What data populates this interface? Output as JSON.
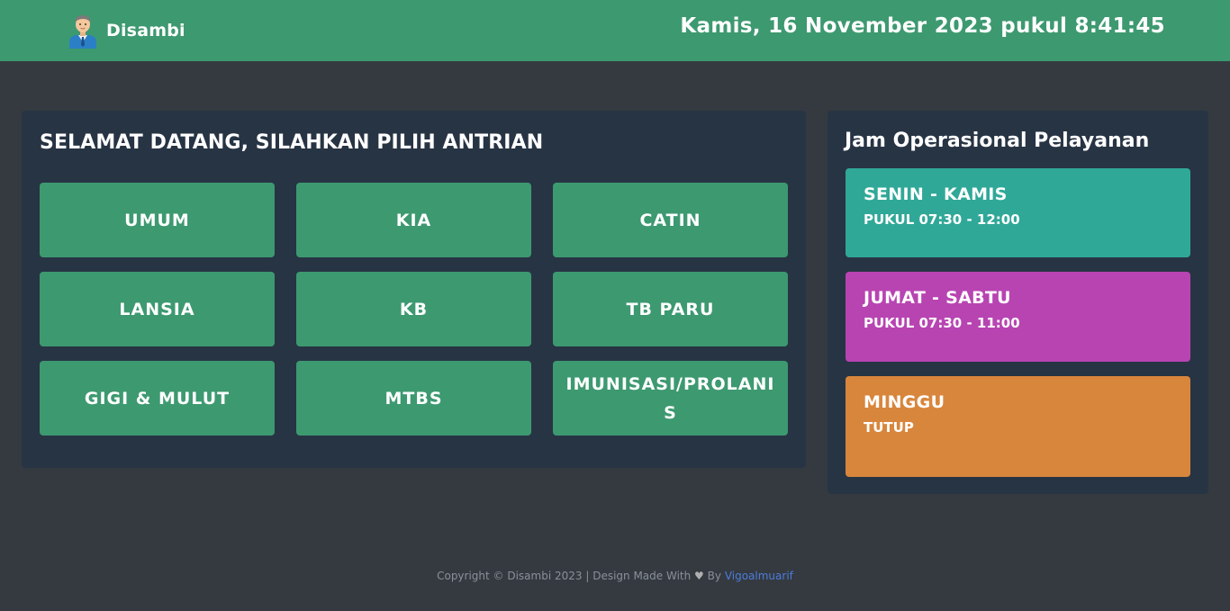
{
  "header": {
    "brand_name": "Disambi",
    "avatar_icon": "businessman-avatar-icon",
    "datetime": "Kamis, 16 November 2023 pukul 8:41:45",
    "background_color": "#3d9970"
  },
  "queue": {
    "title": "SELAMAT DATANG, SILAHKAN PILIH ANTRIAN",
    "button_color": "#3d9970",
    "buttons": [
      {
        "label": "UMUM"
      },
      {
        "label": "KIA"
      },
      {
        "label": "CATIN"
      },
      {
        "label": "LANSIA"
      },
      {
        "label": "KB"
      },
      {
        "label": "TB PARU"
      },
      {
        "label": "GIGI & MULUT"
      },
      {
        "label": "MTBS"
      },
      {
        "label": "IMUNISASI/PROLANIS"
      }
    ]
  },
  "hours": {
    "title": "Jam Operasional Pelayanan",
    "items": [
      {
        "days": "SENIN - KAMIS",
        "time": "PUKUL 07:30 - 12:00",
        "color": "#30a898"
      },
      {
        "days": "JUMAT - SABTU",
        "time": "PUKUL 07:30 - 11:00",
        "color": "#b844b2"
      },
      {
        "days": "MINGGU",
        "time": "TUTUP",
        "color": "#d8863c"
      }
    ]
  },
  "footer": {
    "prefix": "Copyright © Disambi 2023 | Design Made With",
    "heart_icon": "heart-icon",
    "by": "By",
    "author": "Vigoalmuarif"
  }
}
